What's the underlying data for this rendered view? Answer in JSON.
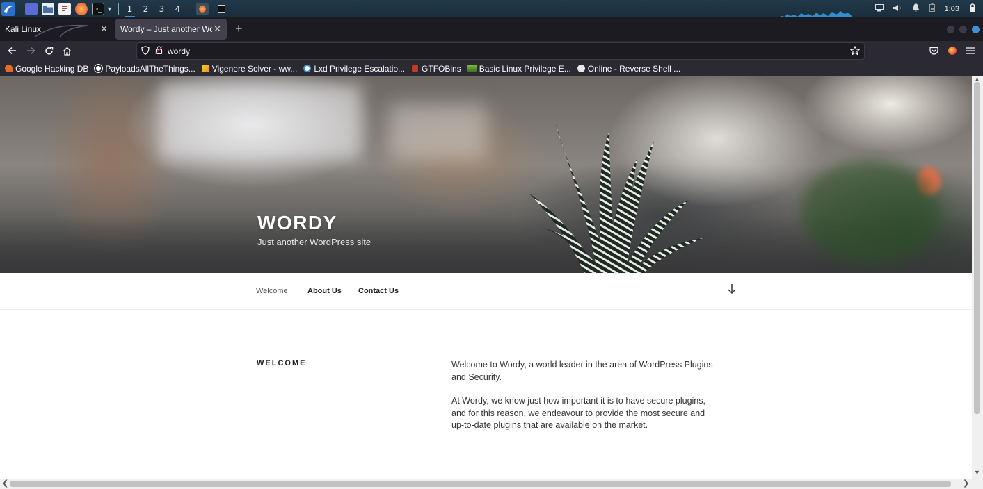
{
  "taskbar": {
    "workspaces": [
      "1",
      "2",
      "3",
      "4"
    ],
    "clock": "1:03"
  },
  "tabs": {
    "inactive_title": "Kali Linux",
    "active_title": "Wordy – Just another WordPress site",
    "new_tab_symbol": "+"
  },
  "nav": {
    "url": "wordy"
  },
  "bookmarks": [
    {
      "label": "Google Hacking DB",
      "icon_color": "#e46a2e",
      "icon": "exploit-db-icon"
    },
    {
      "label": "PayloadsAllTheThings...",
      "icon_color": "#ffffff",
      "icon": "github-icon"
    },
    {
      "label": "Vigenere Solver - ww...",
      "icon_color": "#f0b429",
      "icon": "dcode-icon"
    },
    {
      "label": "Lxd Privilege Escalatio...",
      "icon_color": "#3d8fd6",
      "icon": "wordpress-icon"
    },
    {
      "label": "GTFOBins",
      "icon_color": "#c0392b",
      "icon": "gtfobins-icon"
    },
    {
      "label": "Basic Linux Privilege E...",
      "icon_color": "#7fbf3f",
      "icon": "g0tmi1k-icon"
    },
    {
      "label": "Online - Reverse Shell ...",
      "icon_color": "#dddddd",
      "icon": "skull-icon"
    }
  ],
  "site": {
    "title": "WORDY",
    "description": "Just another WordPress site",
    "menu": [
      "Welcome",
      "About Us",
      "Contact Us"
    ],
    "entry_title": "WELCOME",
    "paragraphs": [
      "Welcome to Wordy, a world leader in the area of WordPress Plugins and Security.",
      "At Wordy, we know just how important it is to have secure plugins, and for this reason, we endeavour to provide the most secure and up-to-date plugins that are available on the market."
    ]
  },
  "colors": {
    "taskbar_bg": "#1f3545",
    "tabstrip_bg": "#1c1b22",
    "toolbar_bg": "#2b2a33",
    "accent": "#3d8fd6"
  }
}
